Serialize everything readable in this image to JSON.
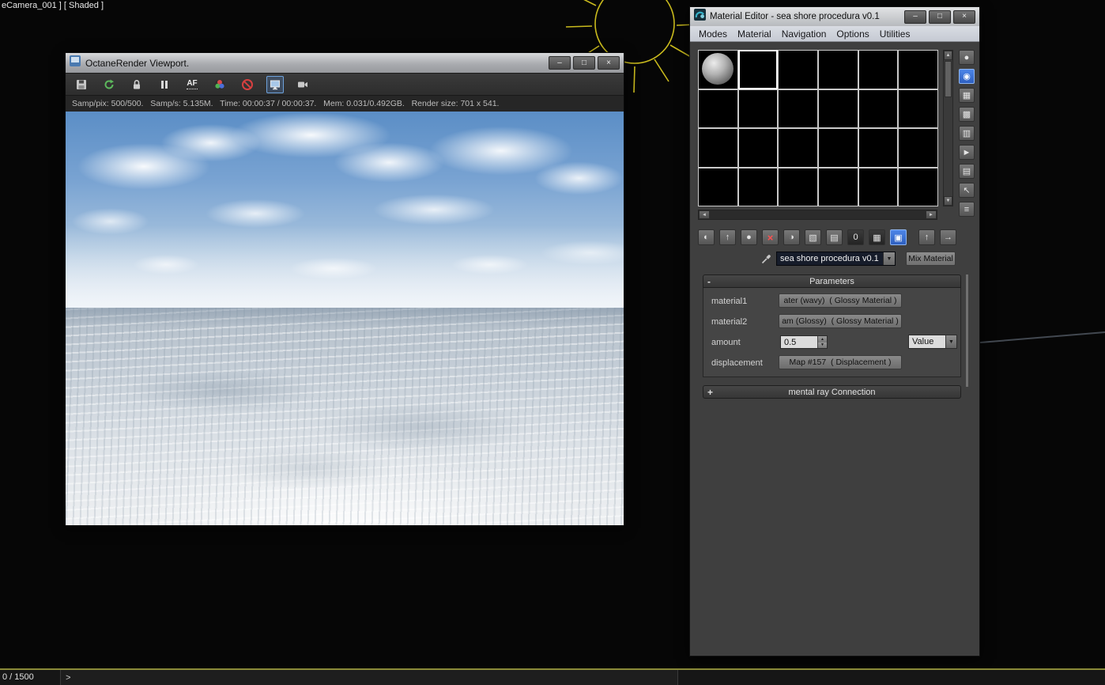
{
  "colors": {
    "accent_blue": "#2d5fc0",
    "reset_red": "#ff5050",
    "sun_yellow": "#c9ba1d",
    "slider_line": "#8a8a38"
  },
  "scene": {
    "viewport_label": "eCamera_001 ] [ Shaded ]"
  },
  "status_bar": {
    "frame_counter": "0 / 1500",
    "prompt": ">"
  },
  "octane": {
    "title": "OctaneRender Viewport.",
    "buttons": {
      "minimize": "–",
      "maximize": "□",
      "close": "×"
    },
    "af_label": "AF",
    "toolbar_icon_names": [
      "save-render-icon",
      "restart-render-icon",
      "lock-thumbnail-icon",
      "pause-render-icon",
      "autofocus-icon",
      "color-wheel-icon",
      "stop-render-icon",
      "display-mode-icon",
      "camera-export-icon"
    ],
    "status": "Samp/pix: 500/500.   Samp/s: 5.135M.   Time: 00:00:37 / 00:00:37.   Mem: 0.031/0.492GB.   Render size: 701 x 541."
  },
  "material_editor": {
    "title": "Material Editor - sea shore procedura v0.1",
    "buttons": {
      "minimize": "–",
      "maximize": "□",
      "close": "×"
    },
    "menus": [
      {
        "label": "Modes"
      },
      {
        "label": "Material"
      },
      {
        "label": "Navigation"
      },
      {
        "label": "Options"
      },
      {
        "label": "Utilities"
      }
    ],
    "slot_scroll": {
      "up": "▲",
      "down": "▼",
      "left": "◄",
      "right": "►"
    },
    "side_toolbar": [
      {
        "name": "sample-type-sphere",
        "glyph": "●"
      },
      {
        "name": "backlight",
        "glyph": "◉"
      },
      {
        "name": "background",
        "glyph": "▦"
      },
      {
        "name": "sample-uv-tiling",
        "glyph": "▩"
      },
      {
        "name": "video-color-check",
        "glyph": "▥"
      },
      {
        "name": "make-preview",
        "glyph": "►"
      },
      {
        "name": "material-editor-options",
        "glyph": "▤"
      },
      {
        "name": "select-by-material",
        "glyph": "↖"
      },
      {
        "name": "material-map-navigator",
        "glyph": "≡"
      }
    ],
    "toolbar": [
      {
        "name": "get-material",
        "glyph": "◐"
      },
      {
        "name": "put-material-to-scene",
        "glyph": "↑"
      },
      {
        "name": "assign-material-to-selection",
        "glyph": "●"
      },
      {
        "name": "reset-map",
        "glyph": "×"
      },
      {
        "name": "make-material-copy",
        "glyph": "◑"
      },
      {
        "name": "make-unique",
        "glyph": "▧"
      },
      {
        "name": "put-to-library",
        "glyph": "▤"
      },
      {
        "name": "material-id-channel",
        "glyph": "0"
      },
      {
        "name": "show-map-in-viewport",
        "glyph": "▦"
      },
      {
        "name": "show-end-result",
        "glyph": "▣"
      },
      {
        "name": "go-to-parent",
        "glyph": "↑"
      },
      {
        "name": "go-forward-to-sibling",
        "glyph": "→"
      }
    ],
    "picker": {
      "material_name": "sea shore procedura v0.1",
      "dropdown_glyph": "▼",
      "type_button": "Mix Material"
    },
    "parameters": {
      "collapse_glyph": "-",
      "title": "Parameters",
      "rows": {
        "material1": {
          "label": "material1",
          "value": "ater (wavy)  ( Glossy Material )"
        },
        "material2": {
          "label": "material2",
          "value": "am (Glossy)  ( Glossy Material )"
        },
        "amount": {
          "label": "amount",
          "value": "0.5",
          "mode": "Value",
          "spin_up": "▲",
          "spin_down": "▼",
          "mode_glyph": "▼"
        },
        "displacement": {
          "label": "displacement",
          "value": "Map #157  ( Displacement )"
        }
      }
    },
    "mental_ray": {
      "expand_glyph": "+",
      "title": "mental ray Connection"
    }
  }
}
